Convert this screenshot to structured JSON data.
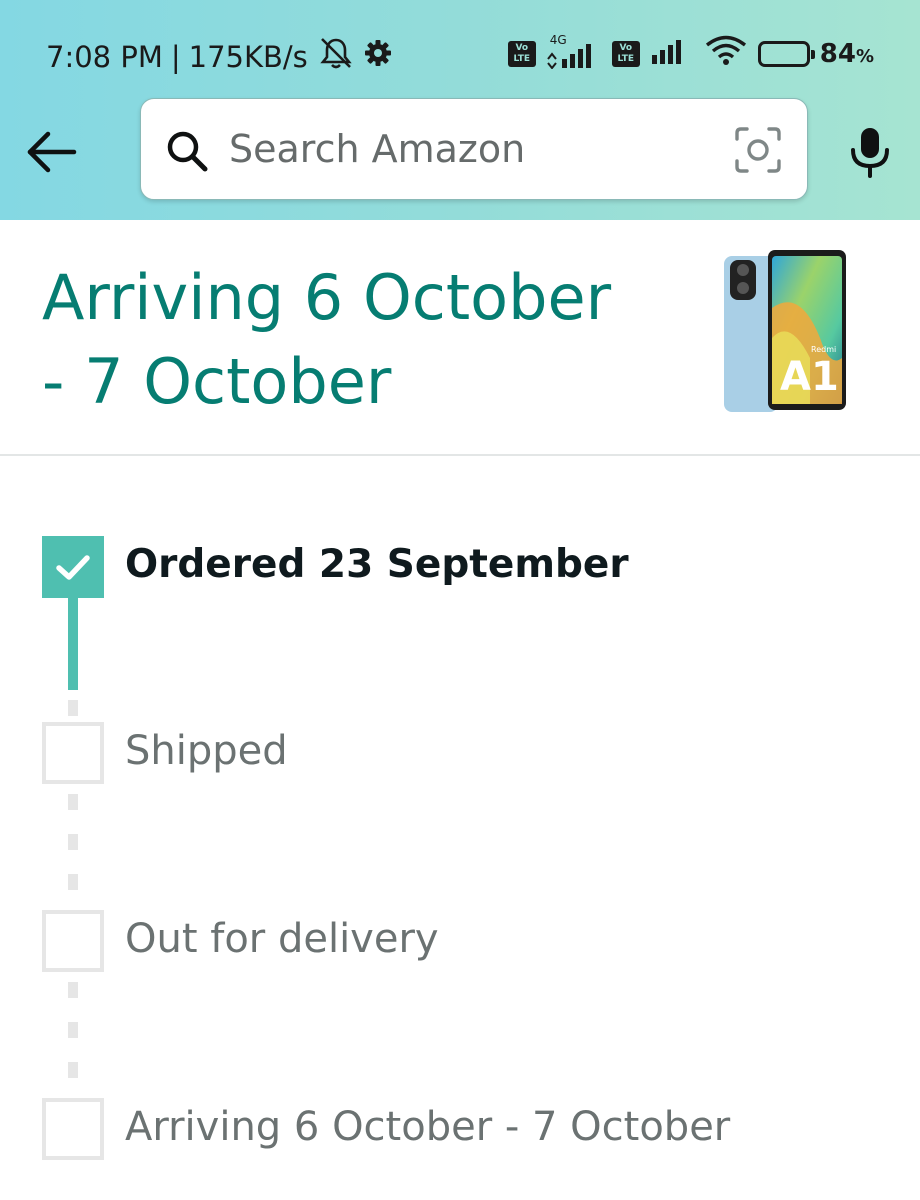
{
  "status_bar": {
    "time": "7:08 PM",
    "separator": "|",
    "speed": "175KB/s",
    "network_label_1": "Vo LTE",
    "network_label_2": "4G",
    "network_label_3": "Vo LTE",
    "battery_percent": "84",
    "battery_unit": "%",
    "battery_level": 0.84
  },
  "search": {
    "placeholder": "Search Amazon"
  },
  "order": {
    "arrival_line1": "Arriving 6 October",
    "arrival_line2": "- 7 October",
    "product_brand": "Redmi",
    "product_model": "A1"
  },
  "tracker": {
    "steps": [
      {
        "label": "Ordered 23 September",
        "done": true
      },
      {
        "label": "Shipped",
        "done": false
      },
      {
        "label": "Out for delivery",
        "done": false
      },
      {
        "label": "Arriving 6 October - 7 October",
        "done": false
      }
    ]
  },
  "colors": {
    "accent_teal": "#067d72",
    "progress_teal": "#4fbfb0",
    "header_gradient_start": "#84d8e3",
    "header_gradient_end": "#a6e4d2"
  },
  "icons": [
    "back-arrow-icon",
    "search-icon",
    "camera-icon",
    "microphone-icon",
    "mute-icon",
    "settings-icon",
    "signal-icon",
    "wifi-icon",
    "battery-icon",
    "checkmark-icon"
  ]
}
